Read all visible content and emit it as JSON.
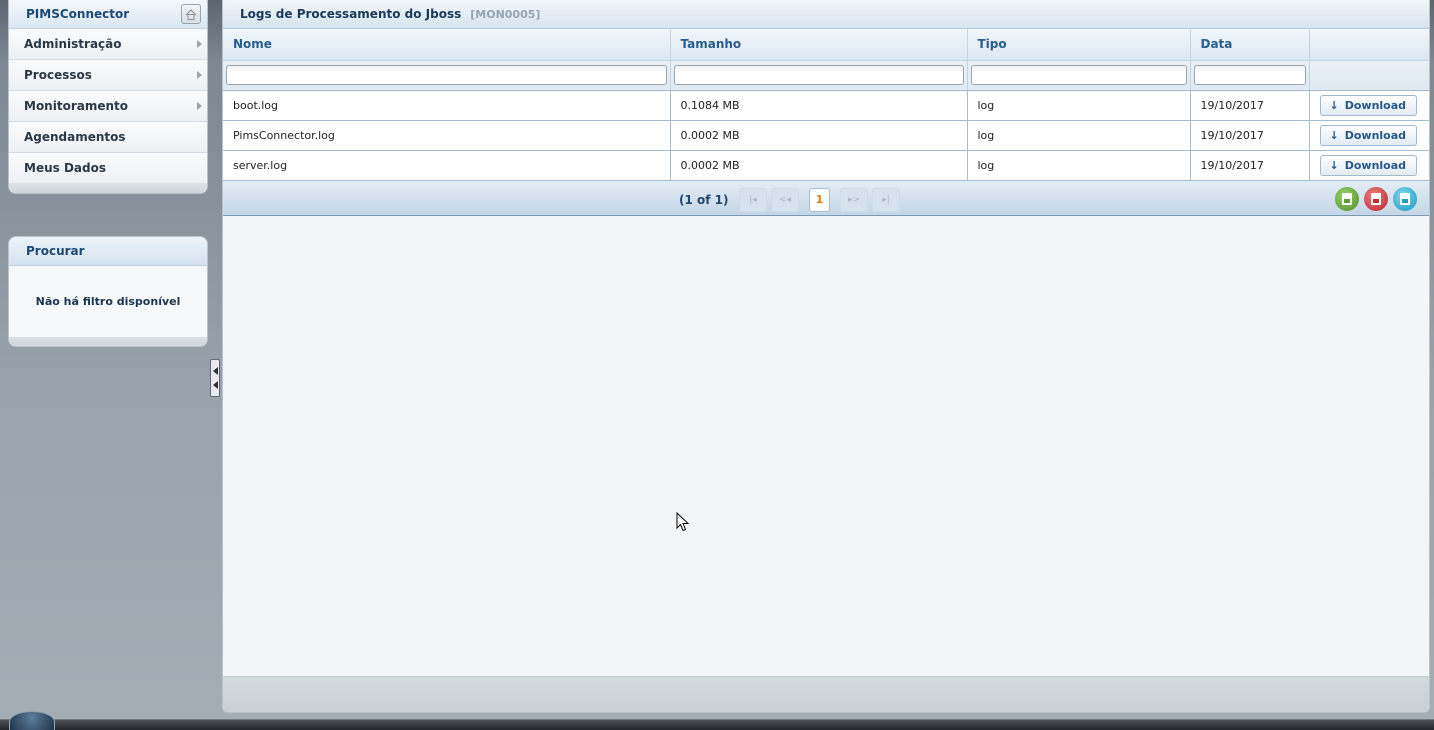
{
  "app": {
    "name": "PIMSConnector"
  },
  "sidebar": {
    "items": [
      {
        "label": "Administração",
        "has_submenu": true
      },
      {
        "label": "Processos",
        "has_submenu": true
      },
      {
        "label": "Monitoramento",
        "has_submenu": true
      },
      {
        "label": "Agendamentos",
        "has_submenu": false
      },
      {
        "label": "Meus Dados",
        "has_submenu": false
      }
    ]
  },
  "search_panel": {
    "title": "Procurar",
    "empty_message": "Não há filtro disponível"
  },
  "main": {
    "title": "Logs de Processamento do Jboss",
    "code": "[MON0005]",
    "columns": [
      "Nome",
      "Tamanho",
      "Tipo",
      "Data"
    ],
    "rows": [
      {
        "nome": "boot.log",
        "tamanho": "0.1084 MB",
        "tipo": "log",
        "data": "19/10/2017",
        "action": "Download"
      },
      {
        "nome": "PimsConnector.log",
        "tamanho": "0.0002 MB",
        "tipo": "log",
        "data": "19/10/2017",
        "action": "Download"
      },
      {
        "nome": "server.log",
        "tamanho": "0.0002 MB",
        "tipo": "log",
        "data": "19/10/2017",
        "action": "Download"
      }
    ],
    "paginator": {
      "current_report": "(1 of 1)",
      "first": "|◂",
      "prev": "<◂",
      "next": "▸>",
      "last": "▸|",
      "page": "1"
    },
    "export_icons": [
      "excel-export-icon",
      "pdf-export-icon",
      "csv-export-icon"
    ]
  },
  "colors": {
    "accent": "#1c4a78",
    "current_page": "#e07b16"
  }
}
